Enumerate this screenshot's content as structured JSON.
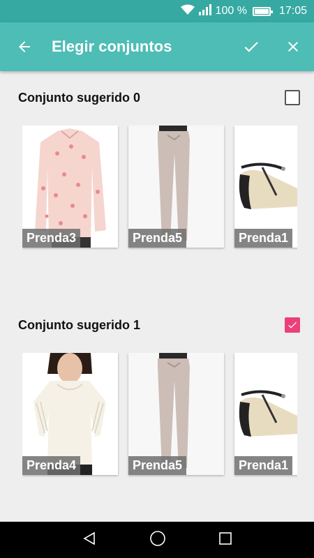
{
  "status_bar": {
    "battery": "100 %",
    "time": "17:05"
  },
  "app_bar": {
    "title": "Elegir conjuntos",
    "back_icon": "arrow-back-icon",
    "confirm_icon": "check-icon",
    "close_icon": "close-icon"
  },
  "groups": [
    {
      "title": "Conjunto sugerido 0",
      "checked": false,
      "items": [
        {
          "label": "Prenda3",
          "image": "floral-blouse"
        },
        {
          "label": "Prenda5",
          "image": "beige-trousers"
        },
        {
          "label": "Prenda1",
          "image": "t-strap-sandal"
        }
      ]
    },
    {
      "title": "Conjunto sugerido 1",
      "checked": true,
      "items": [
        {
          "label": "Prenda4",
          "image": "lace-top"
        },
        {
          "label": "Prenda5",
          "image": "beige-trousers"
        },
        {
          "label": "Prenda1",
          "image": "t-strap-sandal"
        }
      ]
    }
  ],
  "colors": {
    "status_bar": "#36a9a2",
    "app_bar": "#4dbdb5",
    "checkbox_checked": "#ec407a"
  }
}
